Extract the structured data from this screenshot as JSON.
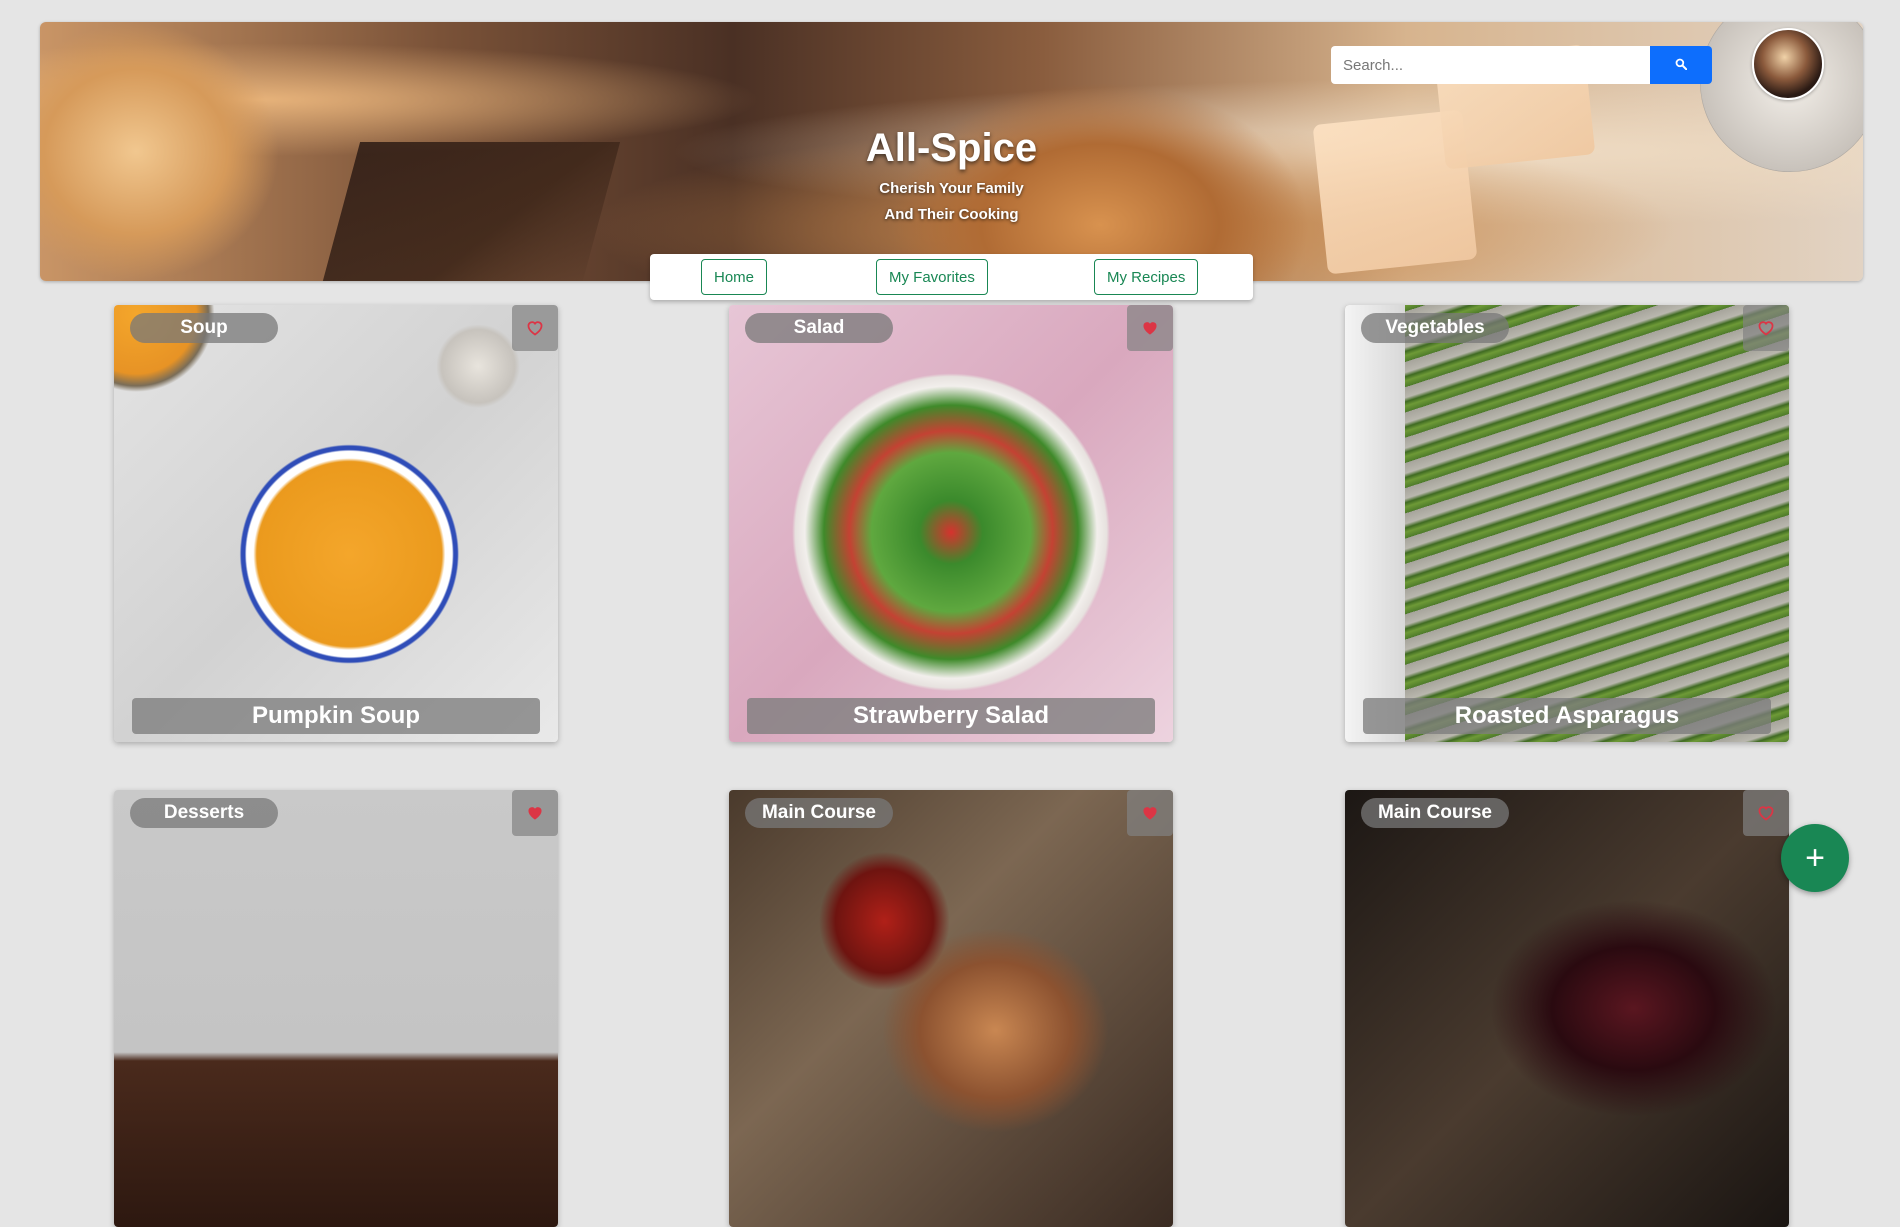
{
  "header": {
    "title": "All-Spice",
    "subtitle_line1": "Cherish Your Family",
    "subtitle_line2": "And Their Cooking",
    "search": {
      "placeholder": "Search...",
      "button_icon": "search-icon"
    },
    "avatar_icon": "user-avatar"
  },
  "nav": {
    "home": "Home",
    "favorites": "My Favorites",
    "recipes": "My Recipes"
  },
  "cards": [
    {
      "category": "Soup",
      "title": "Pumpkin Soup",
      "favorited": false
    },
    {
      "category": "Salad",
      "title": "Strawberry Salad",
      "favorited": true
    },
    {
      "category": "Vegetables",
      "title": "Roasted Asparagus",
      "favorited": false
    },
    {
      "category": "Desserts",
      "title": "",
      "favorited": true
    },
    {
      "category": "Main Course",
      "title": "",
      "favorited": true
    },
    {
      "category": "Main Course",
      "title": "",
      "favorited": false
    }
  ],
  "fab": {
    "label": "+"
  },
  "colors": {
    "primary_green": "#198754",
    "search_blue": "#0d6efd",
    "heart_red": "#dc3545"
  }
}
